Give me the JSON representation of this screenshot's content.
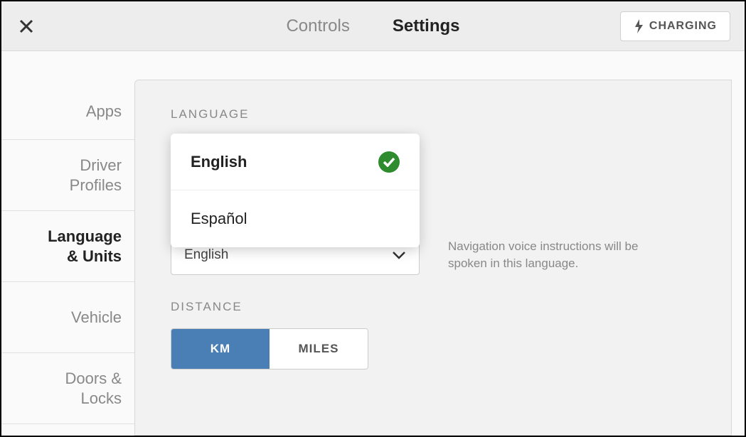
{
  "header": {
    "tabs": {
      "controls": "Controls",
      "settings": "Settings"
    },
    "charging": "CHARGING"
  },
  "sidebar": {
    "apps": "Apps",
    "driver_profiles": "Driver\nProfiles",
    "language_units": "Language\n& Units",
    "vehicle": "Vehicle",
    "doors_locks": "Doors &\nLocks"
  },
  "content": {
    "language_label": "LANGUAGE",
    "language_options": {
      "english": "English",
      "espanol": "Español"
    },
    "nav_voice_selected": "English",
    "nav_voice_help": "Navigation voice instructions will be spoken in this language.",
    "distance_label": "DISTANCE",
    "distance_options": {
      "km": "KM",
      "miles": "MILES"
    }
  }
}
